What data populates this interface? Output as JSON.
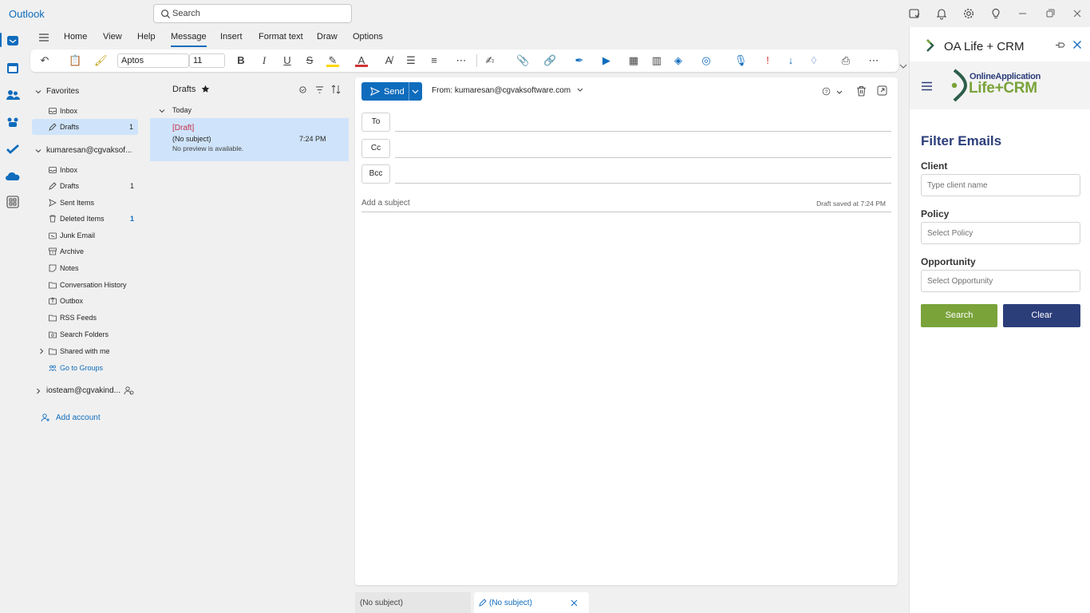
{
  "app": {
    "title": "Outlook"
  },
  "search": {
    "placeholder": "Search"
  },
  "menu": [
    "Home",
    "View",
    "Help",
    "Message",
    "Insert",
    "Format text",
    "Draw",
    "Options"
  ],
  "ribbon": {
    "font": "Aptos",
    "size": "11"
  },
  "folders": {
    "favorites_label": "Favorites",
    "favorites": [
      {
        "label": "Inbox",
        "count": ""
      },
      {
        "label": "Drafts",
        "count": "1"
      }
    ],
    "account": "kumaresan@cgvaksof...",
    "items": [
      {
        "label": "Inbox",
        "count": ""
      },
      {
        "label": "Drafts",
        "count": "1"
      },
      {
        "label": "Sent Items",
        "count": ""
      },
      {
        "label": "Deleted Items",
        "count": "1"
      },
      {
        "label": "Junk Email",
        "count": ""
      },
      {
        "label": "Archive",
        "count": ""
      },
      {
        "label": "Notes",
        "count": ""
      },
      {
        "label": "Conversation History",
        "count": ""
      },
      {
        "label": "Outbox",
        "count": ""
      },
      {
        "label": "RSS Feeds",
        "count": ""
      },
      {
        "label": "Search Folders",
        "count": ""
      },
      {
        "label": "Shared with me",
        "count": ""
      },
      {
        "label": "Go to Groups",
        "count": ""
      }
    ],
    "account2": "iosteam@cgvakind...",
    "add_account": "Add account"
  },
  "msglist": {
    "title": "Drafts",
    "group": "Today",
    "messages": [
      {
        "tag": "[Draft]",
        "subject": "(No subject)",
        "preview": "No preview is available.",
        "time": "7:24 PM"
      }
    ]
  },
  "compose": {
    "send": "Send",
    "from": "From: kumaresan@cgvaksoftware.com",
    "to": "To",
    "cc": "Cc",
    "bcc": "Bcc",
    "subject_placeholder": "Add a subject",
    "draft_saved": "Draft saved at 7:24 PM"
  },
  "tabs": [
    {
      "label": "(No subject)"
    },
    {
      "label": "(No subject)"
    }
  ],
  "addin": {
    "title": "OA Life + CRM",
    "logo_line1": "OnlineApplication",
    "logo_line2": "Life+CRM",
    "heading": "Filter Emails",
    "client_label": "Client",
    "client_placeholder": "Type client name",
    "policy_label": "Policy",
    "policy_placeholder": "Select Policy",
    "opportunity_label": "Opportunity",
    "opportunity_placeholder": "Select Opportunity",
    "search_btn": "Search",
    "clear_btn": "Clear"
  },
  "colors": {
    "accent": "#0f6cbd",
    "brand_green": "#7aa33a",
    "brand_navy": "#2c3e7a",
    "draft_red": "#c4314b",
    "selected_bg": "#cfe4fa"
  }
}
